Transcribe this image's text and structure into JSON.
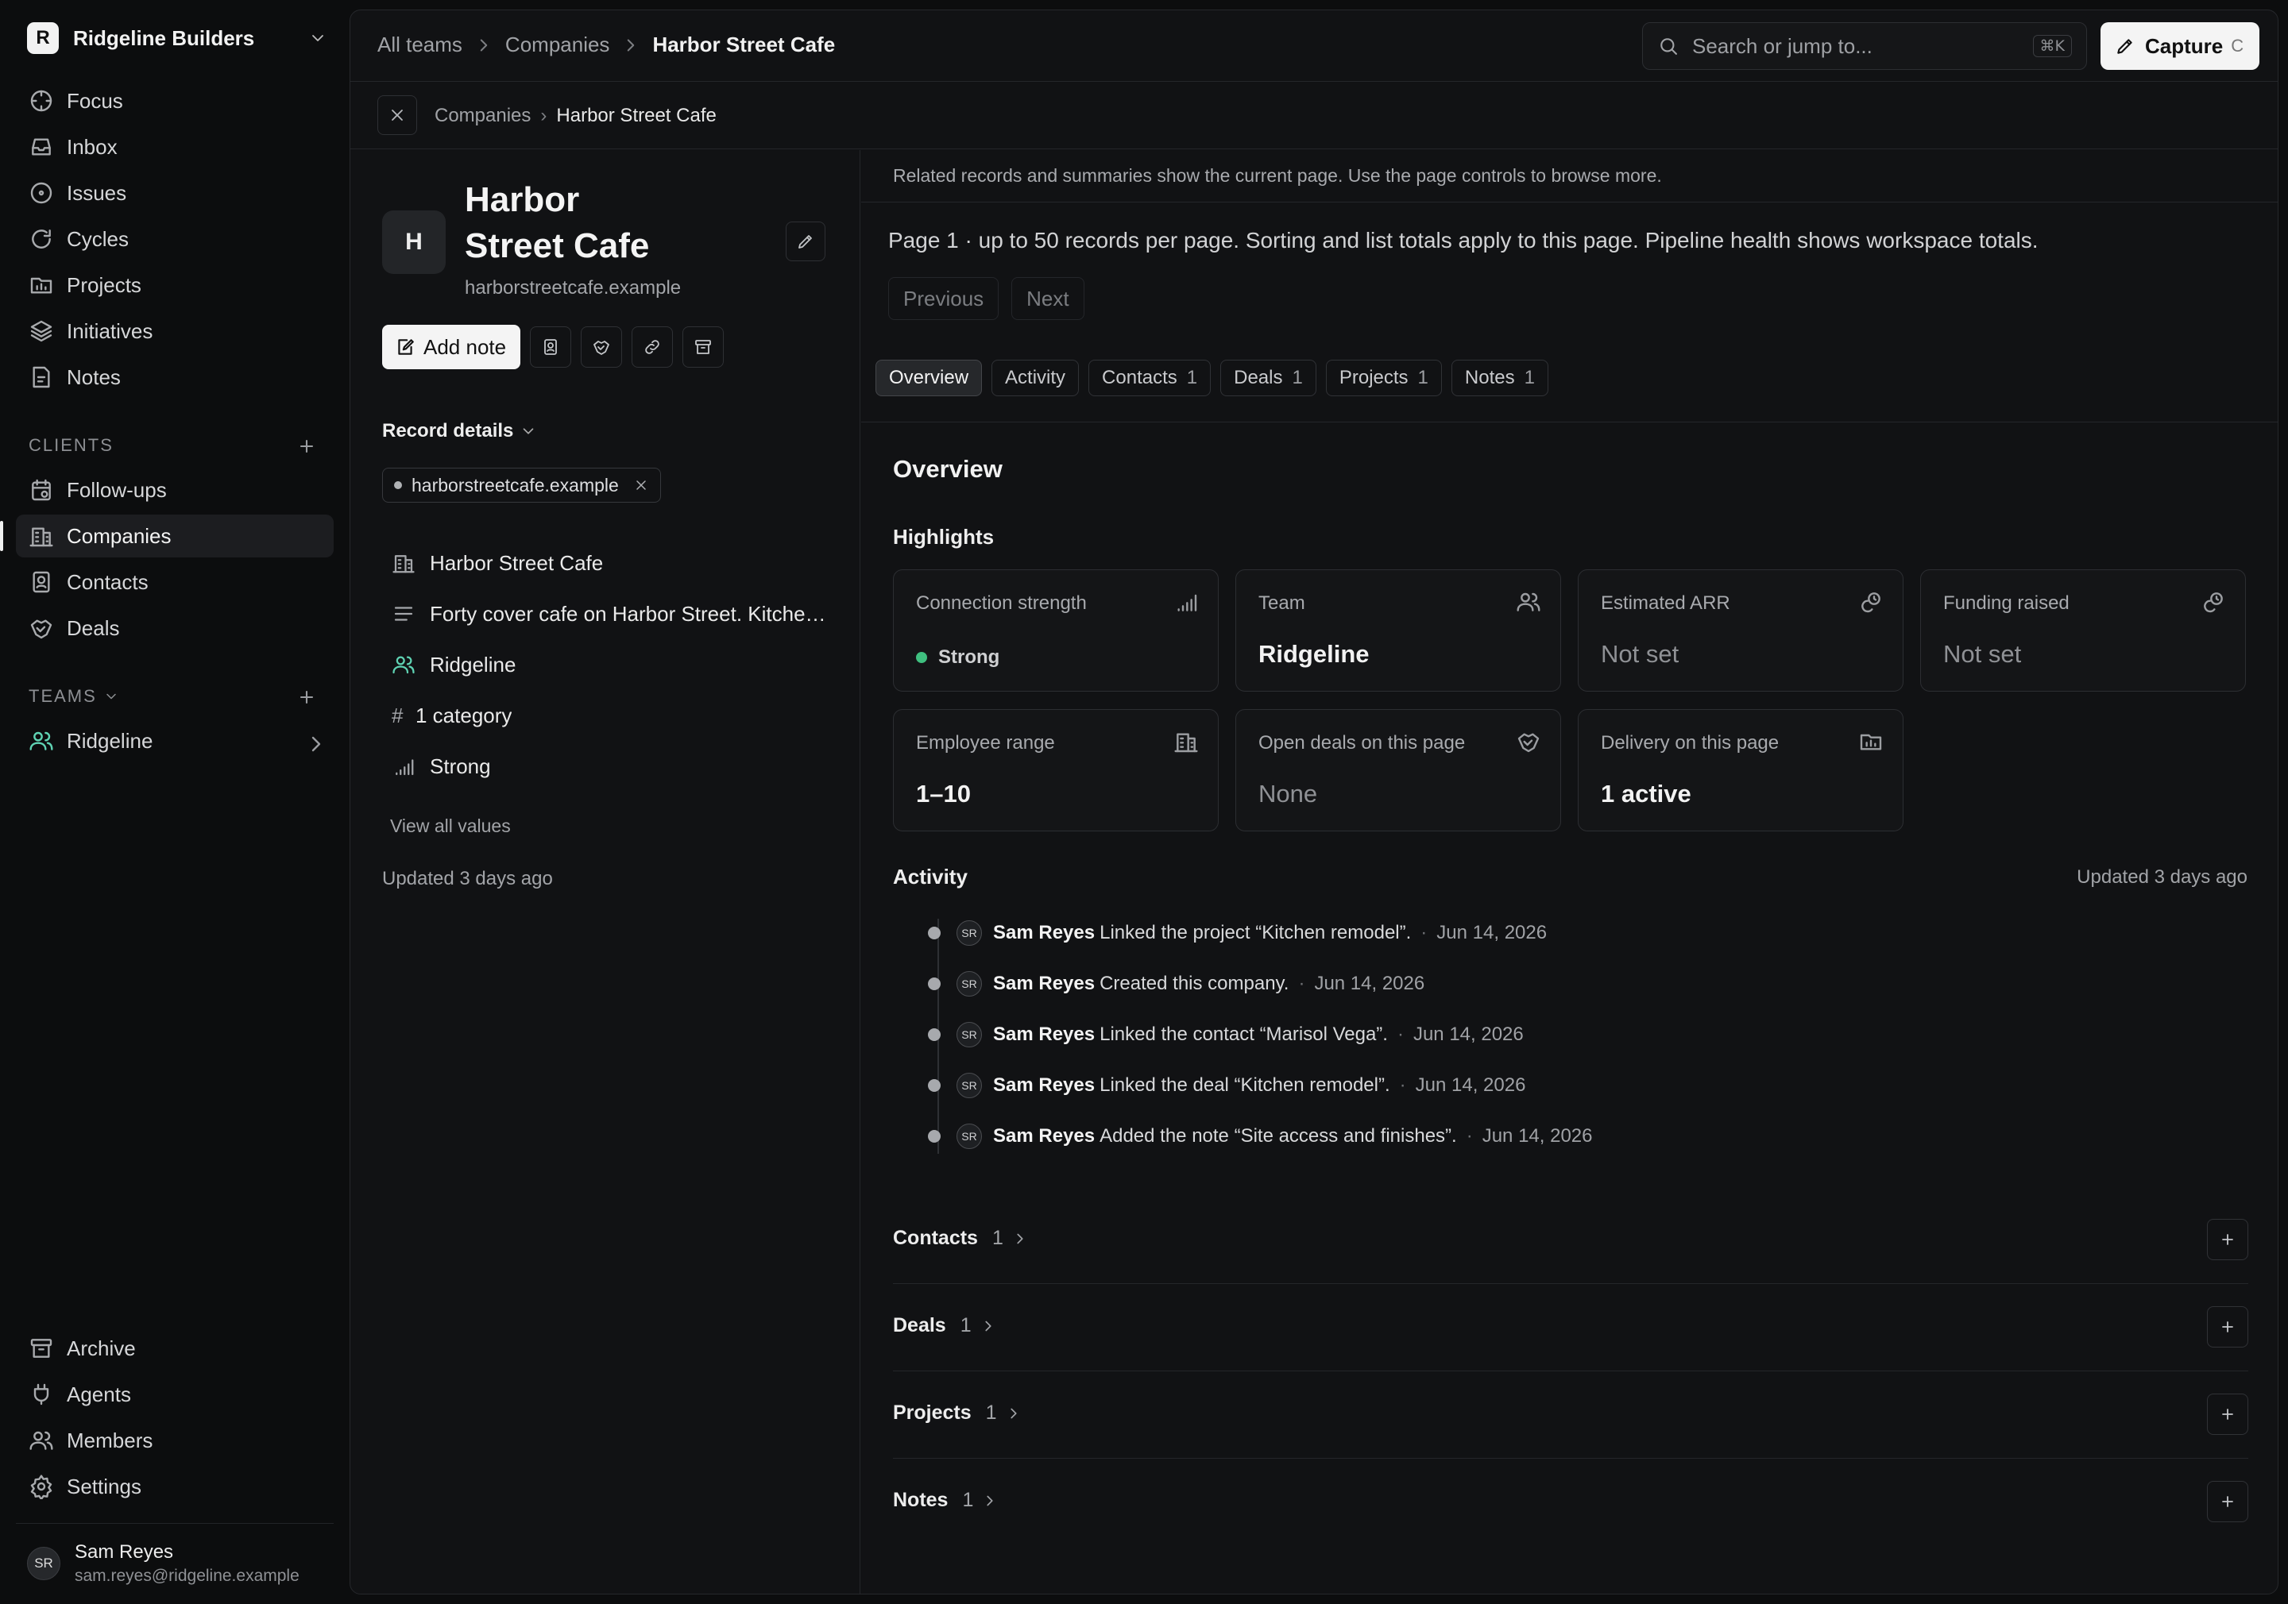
{
  "workspace": {
    "logo_letter": "R",
    "name": "Ridgeline Builders"
  },
  "nav": {
    "main": [
      {
        "label": "Focus",
        "icon": "focus-icon"
      },
      {
        "label": "Inbox",
        "icon": "inbox-icon"
      },
      {
        "label": "Issues",
        "icon": "issues-icon"
      },
      {
        "label": "Cycles",
        "icon": "cycles-icon"
      },
      {
        "label": "Projects",
        "icon": "projects-icon"
      },
      {
        "label": "Initiatives",
        "icon": "initiatives-icon"
      },
      {
        "label": "Notes",
        "icon": "notes-icon"
      }
    ],
    "clients_label": "CLIENTS",
    "clients": [
      {
        "label": "Follow-ups",
        "icon": "follow-ups-icon"
      },
      {
        "label": "Companies",
        "icon": "companies-icon",
        "active": true
      },
      {
        "label": "Contacts",
        "icon": "contacts-icon"
      },
      {
        "label": "Deals",
        "icon": "deals-icon"
      }
    ],
    "teams_label": "TEAMS",
    "teams": [
      {
        "label": "Ridgeline",
        "icon": "team-icon"
      }
    ],
    "bottom": [
      {
        "label": "Archive",
        "icon": "archive-icon"
      },
      {
        "label": "Agents",
        "icon": "agents-icon"
      },
      {
        "label": "Members",
        "icon": "members-icon"
      },
      {
        "label": "Settings",
        "icon": "settings-icon"
      }
    ]
  },
  "user": {
    "initials": "SR",
    "name": "Sam Reyes",
    "email": "sam.reyes@ridgeline.example"
  },
  "topbar": {
    "breadcrumbs": [
      "All teams",
      "Companies",
      "Harbor Street Cafe"
    ],
    "search_placeholder": "Search or jump to...",
    "search_shortcut": "⌘K",
    "capture_label": "Capture",
    "capture_hint": "C"
  },
  "subbar": {
    "breadcrumbs": [
      "Companies",
      "Harbor Street Cafe"
    ],
    "separator": "›"
  },
  "record": {
    "logo_letter": "H",
    "name_line1": "Harbor",
    "name_line2": "Street Cafe",
    "domain": "harborstreetcafe.example",
    "add_note_label": "Add note",
    "record_details_label": "Record details",
    "domain_chip": "harborstreetcafe.example",
    "properties": {
      "name": "Harbor Street Cafe",
      "description": "Forty cover cafe on Harbor Street. Kitchen remodel scoped for this season.",
      "team": "Ridgeline",
      "categories": "1 category",
      "categories_symbol": "#",
      "connection": "Strong"
    },
    "view_all_label": "View all values",
    "updated": "Updated 3 days ago"
  },
  "content": {
    "info_text": "Related records and summaries show the current page. Use the page controls to browse more.",
    "page_note": "Page 1 · up to 50 records per page. Sorting and list totals apply to this page. Pipeline health shows workspace totals.",
    "prev_label": "Previous",
    "next_label": "Next",
    "tabs": [
      {
        "label": "Overview",
        "count": "",
        "active": true
      },
      {
        "label": "Activity",
        "count": ""
      },
      {
        "label": "Contacts",
        "count": "1"
      },
      {
        "label": "Deals",
        "count": "1"
      },
      {
        "label": "Projects",
        "count": "1"
      },
      {
        "label": "Notes",
        "count": "1"
      }
    ],
    "overview_title": "Overview",
    "highlights_title": "Highlights",
    "highlights": [
      {
        "label": "Connection strength",
        "value": "Strong",
        "icon": "signal-icon",
        "status_color": "#3fbf7f"
      },
      {
        "label": "Team",
        "value": "Ridgeline",
        "icon": "team-icon"
      },
      {
        "label": "Estimated ARR",
        "value": "Not set",
        "icon": "arr-icon",
        "muted": true
      },
      {
        "label": "Funding raised",
        "value": "Not set",
        "icon": "funding-icon",
        "muted": true
      },
      {
        "label": "Employee range",
        "value": "1–10",
        "icon": "building-icon"
      },
      {
        "label": "Open deals on this page",
        "value": "None",
        "icon": "handshake-icon",
        "muted": true
      },
      {
        "label": "Delivery on this page",
        "value": "1 active",
        "icon": "delivery-icon"
      }
    ],
    "activity_title": "Activity",
    "activity_updated": "Updated 3 days ago",
    "activity": [
      {
        "initials": "SR",
        "actor": "Sam Reyes",
        "text": "Linked the project “Kitchen remodel”.",
        "date": "Jun 14, 2026"
      },
      {
        "initials": "SR",
        "actor": "Sam Reyes",
        "text": "Created this company.",
        "date": "Jun 14, 2026"
      },
      {
        "initials": "SR",
        "actor": "Sam Reyes",
        "text": "Linked the contact “Marisol Vega”.",
        "date": "Jun 14, 2026"
      },
      {
        "initials": "SR",
        "actor": "Sam Reyes",
        "text": "Linked the deal “Kitchen remodel”.",
        "date": "Jun 14, 2026"
      },
      {
        "initials": "SR",
        "actor": "Sam Reyes",
        "text": "Added the note “Site access and finishes”.",
        "date": "Jun 14, 2026"
      }
    ],
    "related": [
      {
        "label": "Contacts",
        "count": "1"
      },
      {
        "label": "Deals",
        "count": "1"
      },
      {
        "label": "Projects",
        "count": "1"
      },
      {
        "label": "Notes",
        "count": "1"
      }
    ]
  }
}
